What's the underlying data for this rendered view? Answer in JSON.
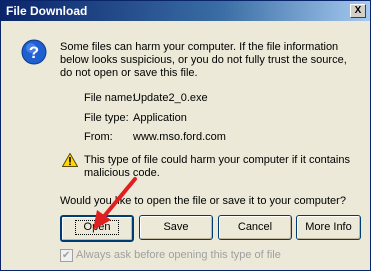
{
  "window": {
    "title": "File Download",
    "close_label": "X"
  },
  "message": "Some files can harm your computer. If the file information below looks suspicious, or you do not fully trust the source, do not open or save this file.",
  "file_info": [
    {
      "label": "File name:",
      "value": "Update2_0.exe"
    },
    {
      "label": "File type:",
      "value": "Application"
    },
    {
      "label": "From:",
      "value": "www.mso.ford.com"
    }
  ],
  "caution": "This type of file could harm your computer if it contains malicious code.",
  "question": "Would you like to open the file or save it to your computer?",
  "buttons": {
    "open": "Open",
    "save": "Save",
    "cancel": "Cancel",
    "more_info": "More Info"
  },
  "checkbox": {
    "label": "Always ask before opening this type of file",
    "checked": true
  },
  "colors": {
    "titlebar": "#0a246a",
    "dialog_bg": "#ece9d8",
    "arrow": "#e02020"
  }
}
